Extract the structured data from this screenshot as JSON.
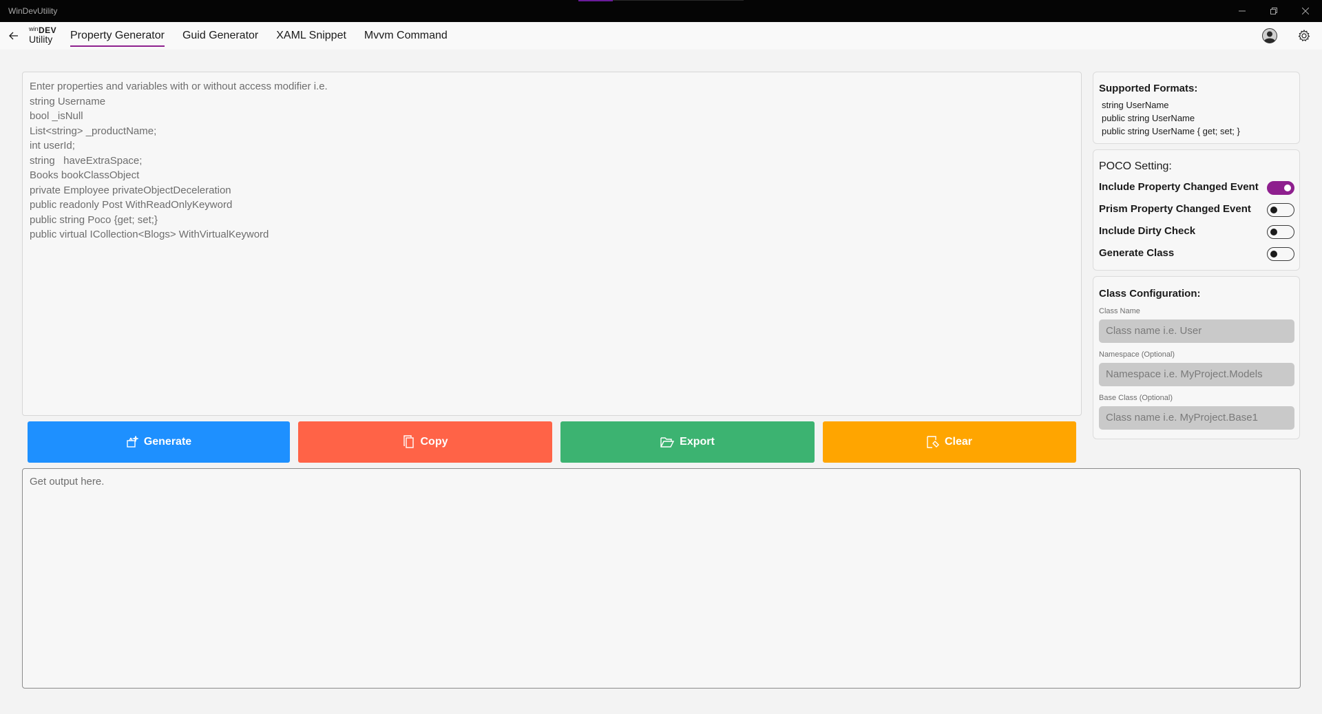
{
  "window": {
    "title": "WinDevUtility"
  },
  "logo": {
    "win": "win",
    "dev": "DEV",
    "utility": "Utility"
  },
  "nav": {
    "tabs": [
      {
        "label": "Property Generator",
        "active": true
      },
      {
        "label": "Guid Generator",
        "active": false
      },
      {
        "label": "XAML Snippet",
        "active": false
      },
      {
        "label": "Mvvm Command",
        "active": false
      }
    ]
  },
  "input": {
    "lines": [
      "Enter properties and variables with or without access modifier i.e.",
      "string Username",
      "bool _isNull",
      "List<string> _productName;",
      "int userId;",
      "string   haveExtraSpace;",
      "Books bookClassObject",
      "private Employee privateObjectDeceleration",
      "public readonly Post WithReadOnlyKeyword",
      "public string Poco {get; set;}",
      "public virtual ICollection<Blogs> WithVirtualKeyword"
    ]
  },
  "actions": {
    "generate": "Generate",
    "copy": "Copy",
    "export": "Export",
    "clear": "Clear"
  },
  "output": {
    "placeholder": "Get output here."
  },
  "formats": {
    "title": "Supported Formats:",
    "lines": [
      "string UserName",
      "public string UserName",
      "public string UserName { get; set; }"
    ]
  },
  "poco": {
    "title": "POCO Setting:",
    "options": [
      {
        "label": "Include Property Changed Event",
        "on": true
      },
      {
        "label": "Prism Property Changed Event",
        "on": false
      },
      {
        "label": "Include Dirty Check",
        "on": false
      },
      {
        "label": "Generate Class",
        "on": false
      }
    ]
  },
  "class_config": {
    "title": "Class Configuration:",
    "class_name_label": "Class Name",
    "class_name_placeholder": "Class name i.e. User",
    "namespace_label": "Namespace (Optional)",
    "namespace_placeholder": "Namespace i.e. MyProject.Models",
    "base_class_label": "Base Class (Optional)",
    "base_class_placeholder": "Class name i.e. MyProject.Base1"
  },
  "colors": {
    "accent": "#8e1f8e",
    "generate": "#1e90ff",
    "copy": "#ff6347",
    "export": "#3cb371",
    "clear": "#ffa500"
  },
  "icons": {
    "back": "arrow-left-icon",
    "avatar": "user-avatar-icon",
    "settings": "gear-icon",
    "generate": "generate-sparkle-icon",
    "copy": "copy-icon",
    "export": "folder-open-icon",
    "clear": "clear-icon"
  }
}
